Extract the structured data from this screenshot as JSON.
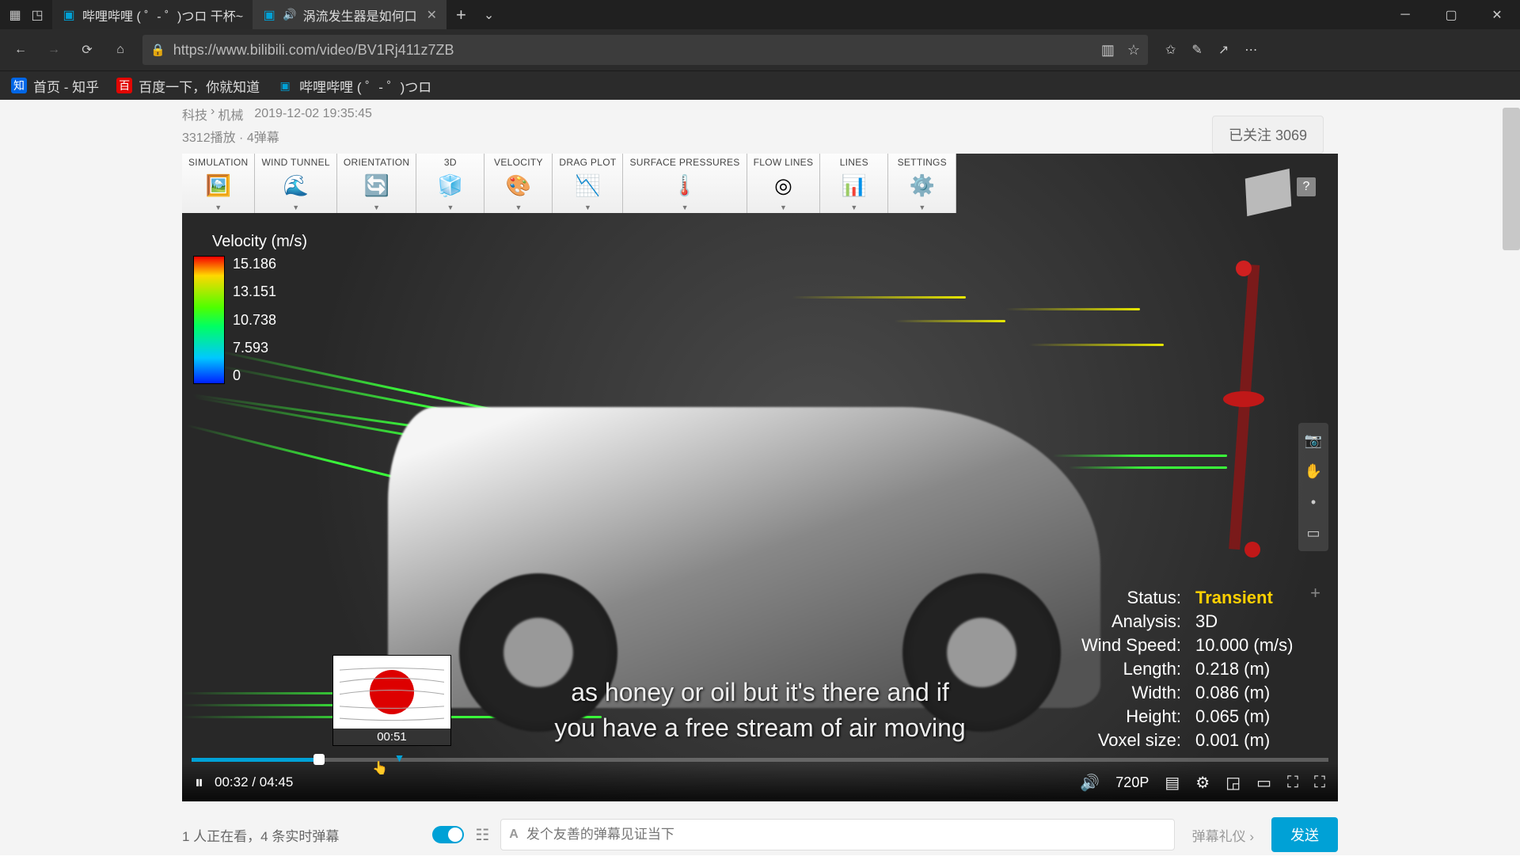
{
  "browser": {
    "tabs": [
      {
        "title": "哔哩哔哩 ( ゜- ゜)つロ 干杯~"
      },
      {
        "title": "涡流发生器是如何口",
        "audio": true,
        "active": true
      }
    ],
    "url": "https://www.bilibili.com/video/BV1Rj411z7ZB",
    "bookmarks": [
      {
        "label": "首页 - 知乎"
      },
      {
        "label": "百度一下，你就知道"
      },
      {
        "label": "哔哩哔哩 ( ゜- ゜)つロ"
      }
    ]
  },
  "page": {
    "breadcrumb": [
      "科技",
      "机械"
    ],
    "upload_time": "2019-12-02 19:35:45",
    "stats": "3312播放 · 4弹幕",
    "follow": "已关注 3069"
  },
  "sim": {
    "tools": [
      "SIMULATION",
      "WIND TUNNEL",
      "ORIENTATION",
      "3D",
      "VELOCITY",
      "DRAG PLOT",
      "SURFACE PRESSURES",
      "FLOW LINES",
      "LINES",
      "SETTINGS"
    ],
    "tool_icons": [
      "🖼️",
      "🌊",
      "🔄",
      "🧊",
      "🎨",
      "📉",
      "🌡️",
      "◎",
      "📊",
      "⚙️"
    ],
    "legend_title": "Velocity (m/s)",
    "legend_values": [
      "15.186",
      "13.151",
      "10.738",
      "7.593",
      "0"
    ],
    "info": {
      "Status": "Transient",
      "Analysis": "3D",
      "Wind Speed": "10.000 (m/s)",
      "Length": "0.218 (m)",
      "Width": "0.086 (m)",
      "Height": "0.065 (m)",
      "Voxel size": "0.001 (m)"
    },
    "help": "?"
  },
  "subtitle": {
    "line1": "as honey or oil but it's there and if",
    "line2": "you have a free stream of air moving"
  },
  "preview": {
    "time": "00:51"
  },
  "player": {
    "current": "00:32",
    "total": "04:45",
    "quality": "720P"
  },
  "danmaku": {
    "watching": "1 人正在看，4 条实时弹幕",
    "placeholder": "发个友善的弹幕见证当下",
    "gift": "弹幕礼仪",
    "send": "发送",
    "font_icon_label": "A"
  }
}
